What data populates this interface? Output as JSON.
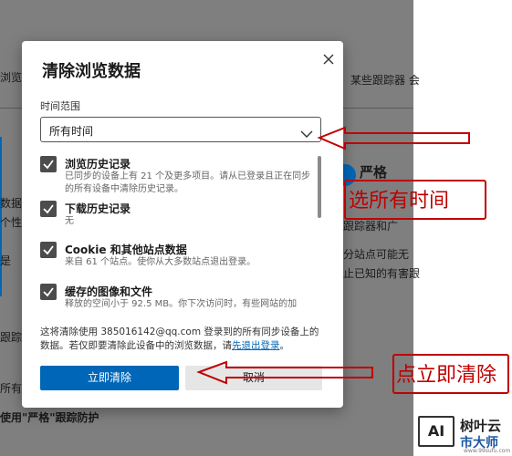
{
  "background": {
    "top_right_text": "，某些跟踪器 会",
    "left_fragments": [
      "浏览",
      "数据",
      "个性",
      "是",
      "跟踪的",
      "所有跟",
      "使用\"严格\"跟踪防护"
    ],
    "strict_label": "严格",
    "right_fragments": [
      "广告",
      "跟踪器和广",
      "分站点可能无",
      "止已知的有害跟"
    ]
  },
  "dialog": {
    "title": "清除浏览数据",
    "close_icon": "close-icon",
    "time_range_label": "时间范围",
    "time_range_value": "所有时间",
    "items": [
      {
        "title": "浏览历史记录",
        "desc": "已同步的设备上有 21 个及更多项目。请从已登录且正在同步的所有设备中清除历史记录。",
        "checked": true
      },
      {
        "title": "下载历史记录",
        "desc": "无",
        "checked": true
      },
      {
        "title": "Cookie 和其他站点数据",
        "desc": "来自 61 个站点。使你从大多数站点退出登录。",
        "checked": true
      },
      {
        "title": "缓存的图像和文件",
        "desc": "释放的空间小于 92.5 MB。你下次访问时，有些网站的加",
        "checked": true
      }
    ],
    "footnote": "这将清除使用 385016142@qq.com 登录到的所有同步设备上的数据。若仅即要清除此设备中的浏览数据，请",
    "footnote_link": "先退出登录",
    "footnote_end": "。",
    "clear_button": "立即清除",
    "cancel_button": "取消"
  },
  "annotations": {
    "select_all_time": "选所有时间",
    "click_clear": "点立即清除",
    "color": "#c00000"
  },
  "watermark": {
    "logo_text": "AI",
    "line1": "树叶云",
    "line2": "市大师",
    "url": "www.99sufu.com"
  }
}
